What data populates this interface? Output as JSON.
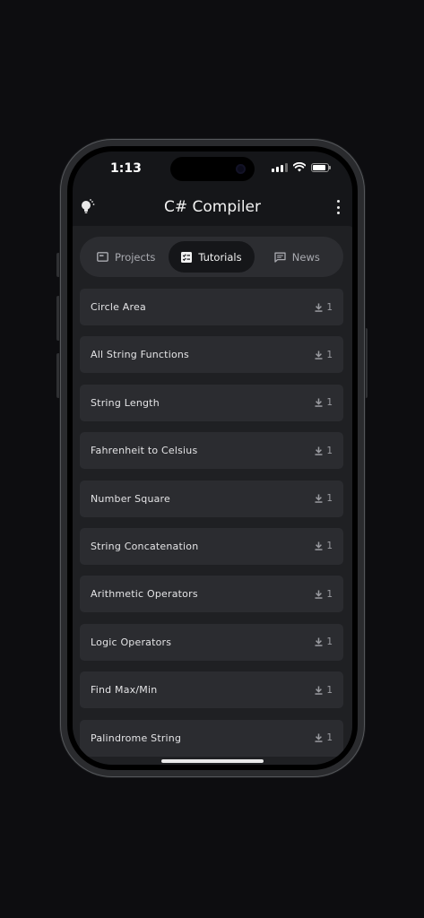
{
  "status_bar": {
    "time": "1:13"
  },
  "app_bar": {
    "title": "C# Compiler",
    "left_icon": "lightbulb-icon",
    "right_icon": "more-vert-icon"
  },
  "tabs": [
    {
      "label": "Projects",
      "icon": "folder-window-icon",
      "active": false
    },
    {
      "label": "Tutorials",
      "icon": "checklist-icon",
      "active": true
    },
    {
      "label": "News",
      "icon": "chat-icon",
      "active": false
    }
  ],
  "tutorials": [
    {
      "title": "Circle Area",
      "downloads": "1"
    },
    {
      "title": "All String Functions",
      "downloads": "1"
    },
    {
      "title": "String Length",
      "downloads": "1"
    },
    {
      "title": "Fahrenheit to Celsius",
      "downloads": "1"
    },
    {
      "title": "Number Square",
      "downloads": "1"
    },
    {
      "title": "String Concatenation",
      "downloads": "1"
    },
    {
      "title": "Arithmetic Operators",
      "downloads": "1"
    },
    {
      "title": "Logic Operators",
      "downloads": "1"
    },
    {
      "title": "Find Max/Min",
      "downloads": "1"
    },
    {
      "title": "Palindrome String",
      "downloads": "1"
    }
  ],
  "colors": {
    "background": "#0d0d10",
    "panel": "#1f2023",
    "item": "#2b2c30",
    "active_tab": "#151619"
  }
}
